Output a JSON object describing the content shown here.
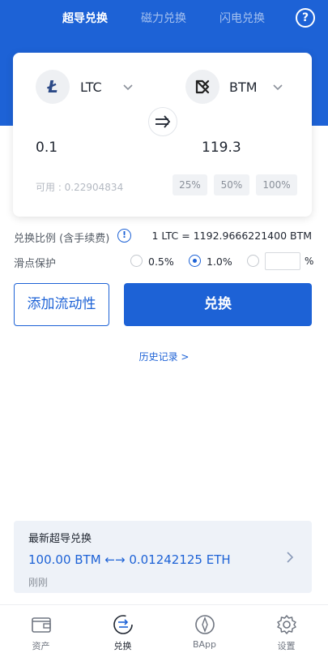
{
  "tabs": [
    {
      "label": "超导兑换",
      "active": true
    },
    {
      "label": "磁力兑换",
      "active": false
    },
    {
      "label": "闪电兑换",
      "active": false
    }
  ],
  "help_label": "?",
  "swap": {
    "from_coin": "LTC",
    "to_coin": "BTM",
    "from_amount": "0.1",
    "to_amount": "119.3",
    "available": "可用 : 0.22904834",
    "percent_options": [
      "25%",
      "50%",
      "100%"
    ]
  },
  "rate": {
    "label": "兑换比例 (含手续费)",
    "value": "1 LTC = 1192.9666221400 BTM"
  },
  "slippage": {
    "label": "滑点保护",
    "options": [
      "0.5%",
      "1.0%"
    ],
    "selected": "1.0%",
    "custom_value": "",
    "percent_sign": "%"
  },
  "buttons": {
    "add_liquidity": "添加流动性",
    "swap": "兑换"
  },
  "history_link": "历史记录 >",
  "latest": {
    "title": "最新超导兑换",
    "trade": "100.00 BTM ←→ 0.01242125 ETH",
    "time": "刚刚"
  },
  "nav": [
    {
      "label": "资产",
      "icon": "wallet-icon"
    },
    {
      "label": "兑换",
      "icon": "exchange-icon",
      "active": true
    },
    {
      "label": "BApp",
      "icon": "compass-icon"
    },
    {
      "label": "设置",
      "icon": "settings-gear-icon"
    }
  ],
  "colors": {
    "primary": "#1d62d6",
    "card_bg": "#eef2f8",
    "muted": "#b4b9c2"
  }
}
